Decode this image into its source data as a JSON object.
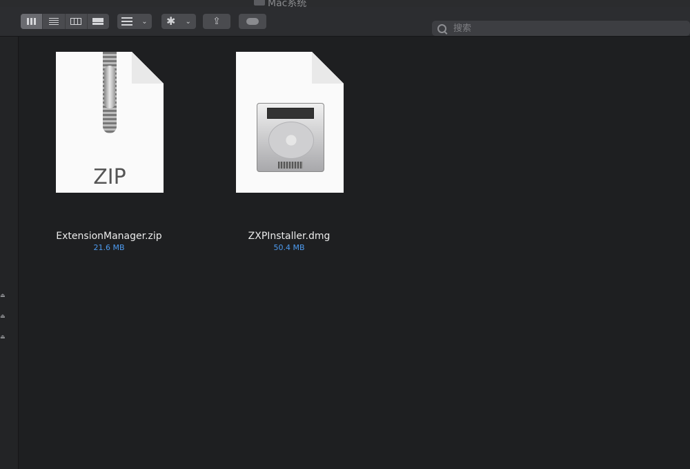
{
  "window": {
    "title": "Mac系统"
  },
  "toolbar": {
    "views": [
      {
        "icon": "icon-view-icon",
        "active": true
      },
      {
        "icon": "list-view-icon"
      },
      {
        "icon": "column-view-icon"
      },
      {
        "icon": "gallery-view-icon"
      }
    ],
    "group_chevron": "⌄",
    "action_icon": "✱",
    "action_chevron": "⌄",
    "share_icon": "⇪",
    "search": {
      "placeholder": "搜索",
      "value": ""
    }
  },
  "sidebar": {
    "eject_glyph": "⏏"
  },
  "files": [
    {
      "name": "ExtensionManager.zip",
      "size": "21.6 MB",
      "icon": "zip-archive-icon",
      "icon_text": "ZIP"
    },
    {
      "name": "ZXPInstaller.dmg",
      "size": "50.4 MB",
      "icon": "disk-image-icon"
    }
  ],
  "colors": {
    "background": "#1e1f21",
    "size_text": "#4d9bf0",
    "name_text": "#ececec"
  }
}
